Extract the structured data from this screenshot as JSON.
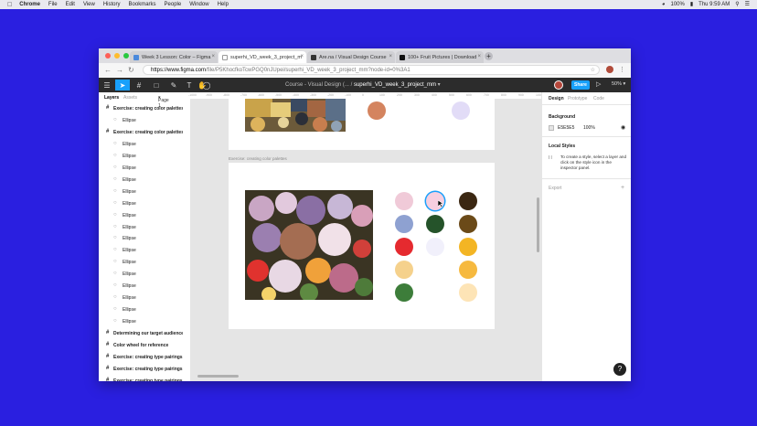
{
  "menubar": {
    "app": "Chrome",
    "items": [
      "File",
      "Edit",
      "View",
      "History",
      "Bookmarks",
      "People",
      "Window",
      "Help"
    ],
    "battery": "100%",
    "clock": "Thu 9:59 AM"
  },
  "tabs": [
    {
      "label": "Week 3 Lesson: Color – Figma",
      "favicon_color": "#4a89dc"
    },
    {
      "label": "superhi_VD_week_3_project_m",
      "favicon_color": "#ffffff"
    },
    {
      "label": "Are.na / Visual Design Course",
      "favicon_color": "#333333"
    },
    {
      "label": "100+ Fruit Pictures | Download",
      "favicon_color": "#111111"
    }
  ],
  "address": {
    "host": "https://www.figma.com",
    "path": "/file/P5KhocfkoTcwPGQ0nJUpei/superhi_VD_week_3_project_mm?node-id=0%3A1"
  },
  "figma_toolbar": {
    "project": "Course - Visual Design (...",
    "separator": "/",
    "file": "superhi_VD_week_3_project_mm",
    "share_label": "Share",
    "zoom": "50%"
  },
  "left_panel": {
    "tabs": [
      "Layers",
      "Assets"
    ],
    "page": "Page 1",
    "layers": [
      {
        "label": "Exercise: creating color palettes",
        "type": "frame"
      },
      {
        "label": "Ellipse",
        "type": "ellipse"
      },
      {
        "label": "Exercise: creating color palettes",
        "type": "frame"
      },
      {
        "label": "Ellipse",
        "type": "ellipse"
      },
      {
        "label": "Ellipse",
        "type": "ellipse"
      },
      {
        "label": "Ellipse",
        "type": "ellipse"
      },
      {
        "label": "Ellipse",
        "type": "ellipse"
      },
      {
        "label": "Ellipse",
        "type": "ellipse"
      },
      {
        "label": "Ellipse",
        "type": "ellipse"
      },
      {
        "label": "Ellipse",
        "type": "ellipse"
      },
      {
        "label": "Ellipse",
        "type": "ellipse"
      },
      {
        "label": "Ellipse",
        "type": "ellipse"
      },
      {
        "label": "Ellipse",
        "type": "ellipse"
      },
      {
        "label": "Ellipse",
        "type": "ellipse"
      },
      {
        "label": "Ellipse",
        "type": "ellipse"
      },
      {
        "label": "Ellipse",
        "type": "ellipse"
      },
      {
        "label": "Ellipse",
        "type": "ellipse"
      },
      {
        "label": "Ellipse",
        "type": "ellipse"
      },
      {
        "label": "Ellipse",
        "type": "ellipse"
      },
      {
        "label": "Determining our target audience",
        "type": "frame"
      },
      {
        "label": "Color wheel for reference",
        "type": "frame"
      },
      {
        "label": "Exercise: creating type pairings",
        "type": "frame"
      },
      {
        "label": "Exercise: creating type pairings",
        "type": "frame"
      },
      {
        "label": "Exercise: creating type pairings",
        "type": "frame"
      }
    ]
  },
  "ruler_ticks": [
    "-1000",
    "-900",
    "-800",
    "-700",
    "-600",
    "-500",
    "-400",
    "-300",
    "-200",
    "-100",
    "0",
    "100",
    "200",
    "300",
    "400",
    "500",
    "600",
    "700",
    "800",
    "900",
    "1000"
  ],
  "canvas": {
    "frame_label": "Exercise: creating color palettes",
    "top_swatches": [
      "#d4845f",
      "#e2dcf7"
    ],
    "palette": [
      "#f0cad8",
      "#f6cfe0",
      "#3b2712",
      "#8ea1d1",
      "#25532a",
      "#6b4a18",
      "#e52a2f",
      "#f1f0fb",
      "#f3b524",
      "#f5d18c",
      null,
      "#f6b93f",
      "#3d7d3a",
      null,
      "#fde4b6"
    ]
  },
  "right_panel": {
    "tabs": [
      "Design",
      "Prototype",
      "Code"
    ],
    "background_title": "Background",
    "background_hex": "E5E5E5",
    "background_opacity": "100%",
    "background_color": "#e5e5e5",
    "local_styles_title": "Local Styles",
    "local_styles_hint": "To create a style, select a layer and click on the style icon in the inspector panel.",
    "export_title": "Export"
  },
  "help_label": "?"
}
